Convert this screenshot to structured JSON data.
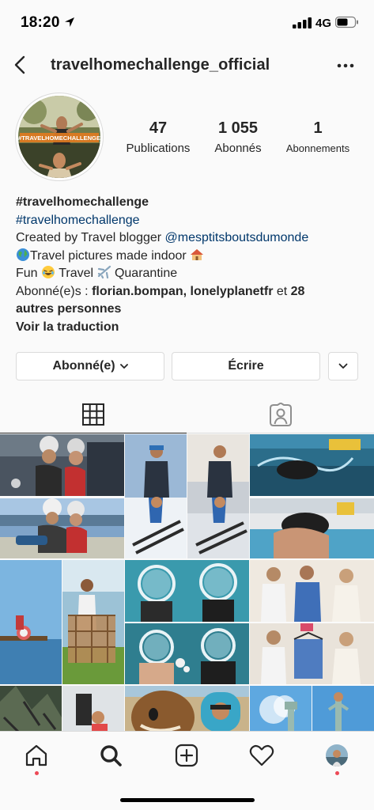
{
  "status_bar": {
    "time": "18:20",
    "network": "4G"
  },
  "header": {
    "username": "travelhomechallenge_official"
  },
  "stats": [
    {
      "value": "47",
      "label": "Publications"
    },
    {
      "value": "1 055",
      "label": "Abonnés"
    },
    {
      "value": "1",
      "label": "Abonnements"
    }
  ],
  "avatar": {
    "banner_text": "#TRAVELHOMECHALLENGE"
  },
  "bio": {
    "name": "#travelhomechallenge",
    "hashtag": "#travelhomechallenge",
    "created_prefix": "Created by Travel blogger ",
    "created_mention": "@mesptitsboutsdumonde",
    "line3_text": "Travel pictures made indoor",
    "line4_fun": "Fun",
    "line4_travel": "Travel",
    "line4_quarantine": "Quarantine",
    "followed_by_prefix": "Abonné(e)s : ",
    "followed_by_names": "florian.bompan, lonelyplanetfr",
    "followed_by_and": " et ",
    "followed_by_count": "28",
    "followed_by_rest": "autres personnes",
    "translate": "Voir la traduction"
  },
  "actions": {
    "follow_label": "Abonné(e)",
    "message_label": "Écrire"
  },
  "tabs": [
    {
      "name": "grid-icon",
      "active": true
    },
    {
      "name": "tagged-icon",
      "active": false
    }
  ],
  "bottom_nav": [
    {
      "name": "home-icon",
      "notification_dot": true
    },
    {
      "name": "search-icon",
      "active": true
    },
    {
      "name": "add-icon"
    },
    {
      "name": "heart-icon"
    },
    {
      "name": "profile-avatar",
      "notification_dot": true
    }
  ],
  "colors": {
    "link": "#00376b",
    "notification": "#ed4956",
    "border": "#dbdbdb"
  }
}
